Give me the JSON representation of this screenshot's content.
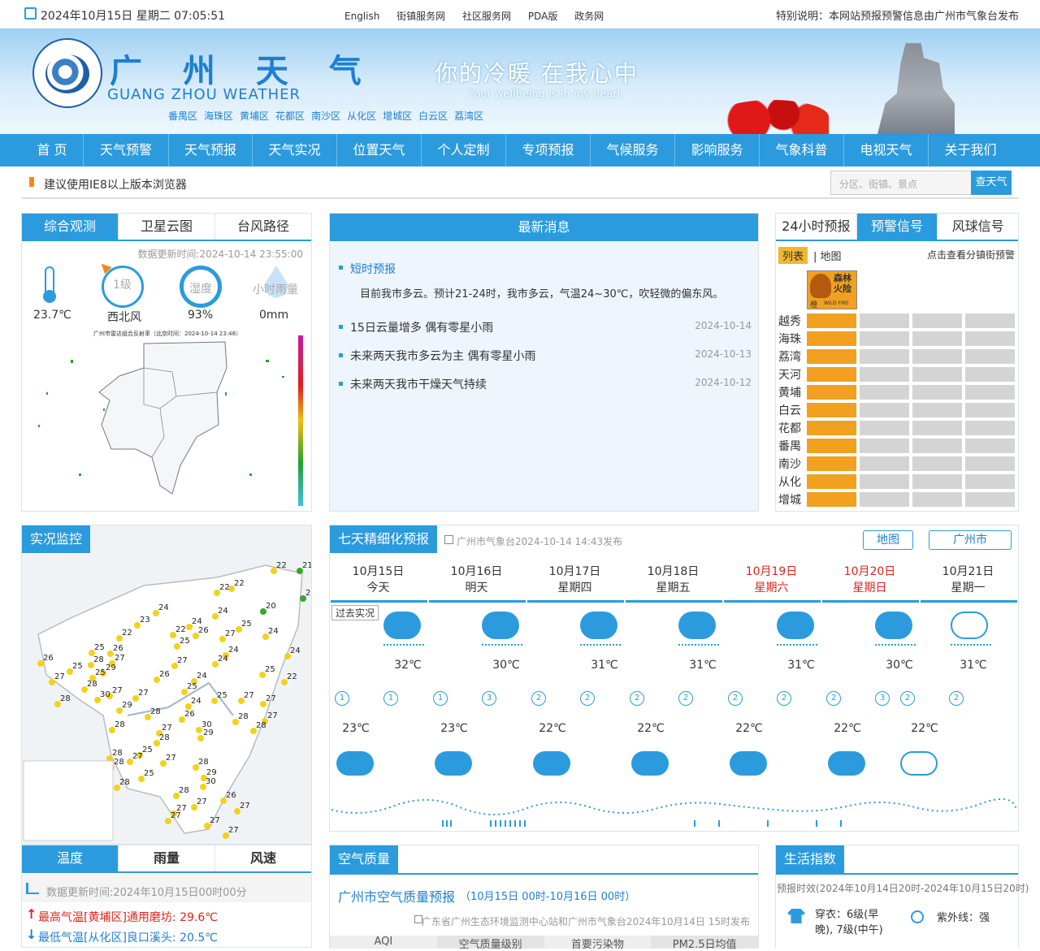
{
  "topbar": {
    "date": "2024年10月15日 星期二 07:05:51",
    "links": [
      "English",
      "街镇服务网",
      "社区服务网",
      "PDA版",
      "政务网"
    ],
    "notice": "特别说明：本网站预报预警信息由广州市气象台发布"
  },
  "header": {
    "title_cn": "广 州 天 气",
    "title_en": "GUANG ZHOU WEATHER",
    "districts": [
      "番禺区",
      "海珠区",
      "黄埔区",
      "花都区",
      "南沙区",
      "从化区",
      "增城区",
      "白云区",
      "荔湾区"
    ],
    "slogan": "你的冷暖   在我心中",
    "slogan_en": "Your wellbeing is in my heart"
  },
  "nav": [
    "首 页",
    "天气预警",
    "天气预报",
    "天气实况",
    "位置天气",
    "个人定制",
    "专项预报",
    "气候服务",
    "影响服务",
    "气象科普",
    "电视天气",
    "关于我们"
  ],
  "tip": {
    "text": "建议使用IE8以上版本浏览器",
    "search_placeholder": "分区、街镇、景点",
    "search_button": "查天气"
  },
  "obs": {
    "tabs": [
      "综合观测",
      "卫星云图",
      "台风路径"
    ],
    "update": "数据更新时间:2024-10-14 23:55:00",
    "temp": "23.7℃",
    "wind_level": "1级",
    "wind_dir": "西北风",
    "humidity_label": "湿度",
    "humidity": "93%",
    "rain_label": "小时雨量",
    "rain": "0mm",
    "radar_title": "广州市雷达组合反射率（北京时间：2024-10-14 23:48）"
  },
  "news": {
    "title": "最新消息",
    "short_label": "短时预报",
    "short_text": "目前我市多云。预计21-24时，我市多云，气温24~30℃，吹轻微的偏东风。",
    "items": [
      {
        "t": "15日云量增多 偶有零星小雨",
        "d": "2024-10-14"
      },
      {
        "t": "未来两天我市多云为主 偶有零星小雨",
        "d": "2024-10-13"
      },
      {
        "t": "未来两天我市干燥天气持续",
        "d": "2024-10-12"
      }
    ]
  },
  "warn": {
    "tabs": [
      "24小时预报",
      "预警信号",
      "风球信号"
    ],
    "list_label": "列表",
    "map_label": "地图",
    "hint": "点击查看分镇街预警",
    "signal_cn": "森林火险",
    "signal_color": "橙",
    "signal_en": "WILD FIRE",
    "districts": [
      "越秀",
      "海珠",
      "荔湾",
      "天河",
      "黄埔",
      "白云",
      "花都",
      "番禺",
      "南沙",
      "从化",
      "增城"
    ]
  },
  "live": {
    "title": "实况监控"
  },
  "seven": {
    "title": "七天精细化预报",
    "source": "广州市气象台2024-10-14 14:43发布",
    "map_btn": "地图",
    "city_btn": "广州市",
    "past_label": "过去实况",
    "days": [
      {
        "date": "10月15日",
        "week": "今天",
        "hi": "32℃",
        "lo": "23℃",
        "wk": false
      },
      {
        "date": "10月16日",
        "week": "明天",
        "hi": "30℃",
        "lo": "23℃",
        "wk": false
      },
      {
        "date": "10月17日",
        "week": "星期四",
        "hi": "31℃",
        "lo": "22℃",
        "wk": false
      },
      {
        "date": "10月18日",
        "week": "星期五",
        "hi": "31℃",
        "lo": "22℃",
        "wk": false
      },
      {
        "date": "10月19日",
        "week": "星期六",
        "hi": "31℃",
        "lo": "22℃",
        "wk": true
      },
      {
        "date": "10月20日",
        "week": "星期日",
        "hi": "30℃",
        "lo": "22℃",
        "wk": true
      },
      {
        "date": "10月21日",
        "week": "星期一",
        "hi": "31℃",
        "lo": "22℃",
        "wk": false
      }
    ],
    "wind": [
      "1",
      "1",
      "1",
      "3",
      "2",
      "2",
      "2",
      "2",
      "2",
      "2",
      "2",
      "3",
      "2",
      "2"
    ]
  },
  "bottom": {
    "tabs": [
      "温度",
      "雨量",
      "风速"
    ],
    "update": "数据更新时间:2024年10月15日00时00分",
    "max": "最高气温[黄埔区]通用磨坊: 29.6℃",
    "min": "最低气温[从化区]良口溪头: 20.5℃"
  },
  "air": {
    "title": "空气质量",
    "forecast": "广州市空气质量预报",
    "range": "（10月15日 00时-10月16日 00时）",
    "source": "广东省广州生态环境监测中心站和广州市气象台2024年10月14日 15时发布",
    "cols": [
      "AQI",
      "空气质量级别",
      "首要污染物",
      "PM2.5日均值"
    ]
  },
  "life": {
    "title": "生活指数",
    "valid": "预报时效(2024年10月14日20时-2024年10月15日20时)",
    "dress": "穿衣：6级(早晚), 7级(中午)",
    "uv": "紫外线：强"
  }
}
